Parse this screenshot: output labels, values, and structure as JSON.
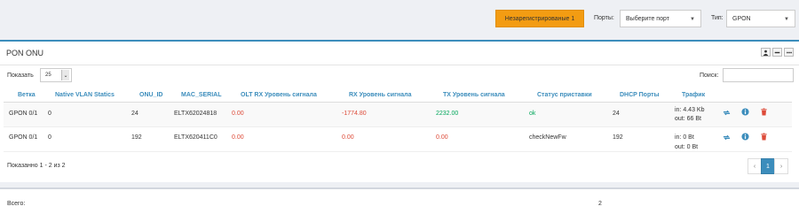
{
  "topbar": {
    "unregistered_button": "Незарегистрированые 1",
    "ports_label": "Порты:",
    "ports_select": "Выберите порт",
    "type_label": "Тип:",
    "type_select": "GPON"
  },
  "panel": {
    "title": "PON ONU",
    "show_label": "Показать",
    "page_length": "25",
    "search_label": "Поиск:",
    "search_value": ""
  },
  "table": {
    "headers": [
      "Ветка",
      "Native VLAN Statics",
      "ONU_ID",
      "MAC_SERIAL",
      "OLT RX Уровень сигнала",
      "RX Уровень сигнала",
      "TX Уровень сигнала",
      "Статус приставки",
      "DHCP Порты",
      "Трафик"
    ],
    "rows": [
      {
        "branch": "GPON 0/1",
        "vlan": "0",
        "onu_id": "24",
        "mac": "ELTX62024818",
        "olt_rx": "0.00",
        "rx": "-1774.80",
        "tx": "2232.00",
        "status": "ok",
        "dhcp": "24",
        "traffic_in": "in: 4.43 Kb",
        "traffic_out": "out: 66 Bt"
      },
      {
        "branch": "GPON 0/1",
        "vlan": "0",
        "onu_id": "192",
        "mac": "ELTX620411C0",
        "olt_rx": "0.00",
        "rx": "0.00",
        "tx": "0.00",
        "status": "checkNewFw",
        "dhcp": "192",
        "traffic_in": "in: 0 Bt",
        "traffic_out": "out: 0 Bt"
      }
    ]
  },
  "info": "Показанно 1 - 2 из 2",
  "pagination": {
    "prev": "‹",
    "current": "1",
    "next": "›"
  },
  "footer": {
    "total_label": "Всего:",
    "total_value": "2"
  },
  "colors": {
    "accent": "#3c8dbc",
    "warning": "#f39c12",
    "danger": "#dd4b39",
    "success": "#00a65a"
  },
  "icons": [
    "refresh-icon",
    "info-icon",
    "trash-icon",
    "user-icon",
    "minus-icon",
    "more-icon",
    "chevron-down-icon"
  ]
}
